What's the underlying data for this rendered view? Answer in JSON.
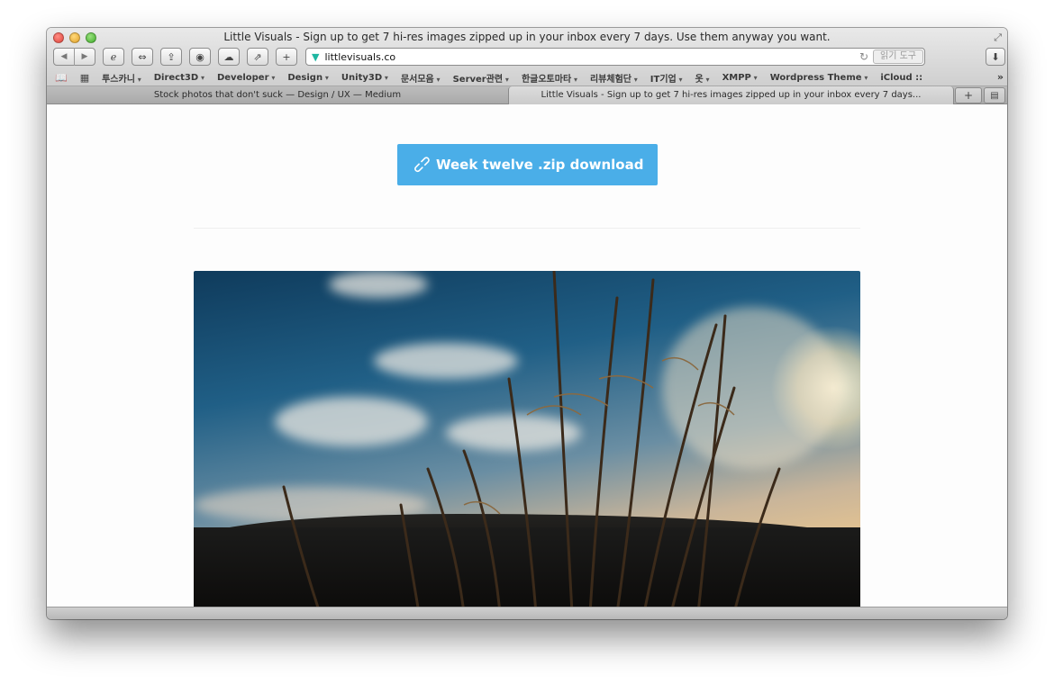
{
  "window": {
    "title": "Little Visuals - Sign up to get 7 hi-res images zipped up in your inbox every 7 days. Use them anyway you want."
  },
  "toolbar": {
    "url": "littlevisuals.co",
    "reader_label": "읽기 도구"
  },
  "bookmarks": [
    {
      "label": "투스카니"
    },
    {
      "label": "Direct3D"
    },
    {
      "label": "Developer"
    },
    {
      "label": "Design"
    },
    {
      "label": "Unity3D"
    },
    {
      "label": "문서모음"
    },
    {
      "label": "Server관련"
    },
    {
      "label": "한글오토마타"
    },
    {
      "label": "리뷰체험단"
    },
    {
      "label": "IT기업"
    },
    {
      "label": "옷"
    },
    {
      "label": "XMPP"
    },
    {
      "label": "Wordpress Theme"
    },
    {
      "label": "iCloud ::"
    }
  ],
  "tabs": [
    {
      "label": "Stock photos that don't suck — Design / UX — Medium"
    },
    {
      "label": "Little Visuals - Sign up to get 7 hi-res images zipped up in your inbox every 7 days..."
    }
  ],
  "content": {
    "download_button": "Week twelve .zip download",
    "accent_color": "#4aaee8"
  }
}
